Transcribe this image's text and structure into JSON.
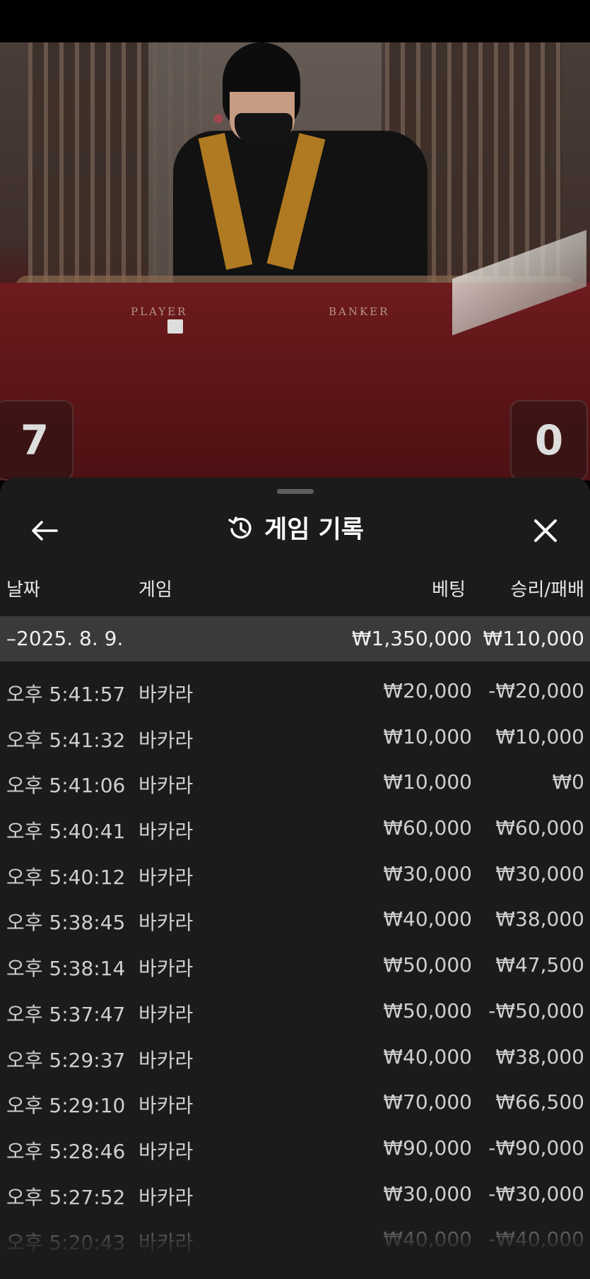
{
  "video": {
    "table_labels": [
      "PLAYER",
      "BANKER"
    ],
    "player_score": "7",
    "banker_score": "0"
  },
  "history": {
    "title": "게임 기록",
    "columns": {
      "date": "날짜",
      "game": "게임",
      "bet": "베팅",
      "result": "승리/패배"
    },
    "group": {
      "date": "–2025. 8. 9.",
      "bet_total": "₩1,350,000",
      "result_total": "₩110,000"
    },
    "rows": [
      {
        "time": "오후 5:41:57",
        "game": "바카라",
        "bet": "₩20,000",
        "result": "-₩20,000"
      },
      {
        "time": "오후 5:41:32",
        "game": "바카라",
        "bet": "₩10,000",
        "result": "₩10,000"
      },
      {
        "time": "오후 5:41:06",
        "game": "바카라",
        "bet": "₩10,000",
        "result": "₩0"
      },
      {
        "time": "오후 5:40:41",
        "game": "바카라",
        "bet": "₩60,000",
        "result": "₩60,000"
      },
      {
        "time": "오후 5:40:12",
        "game": "바카라",
        "bet": "₩30,000",
        "result": "₩30,000"
      },
      {
        "time": "오후 5:38:45",
        "game": "바카라",
        "bet": "₩40,000",
        "result": "₩38,000"
      },
      {
        "time": "오후 5:38:14",
        "game": "바카라",
        "bet": "₩50,000",
        "result": "₩47,500"
      },
      {
        "time": "오후 5:37:47",
        "game": "바카라",
        "bet": "₩50,000",
        "result": "-₩50,000"
      },
      {
        "time": "오후 5:29:37",
        "game": "바카라",
        "bet": "₩40,000",
        "result": "₩38,000"
      },
      {
        "time": "오후 5:29:10",
        "game": "바카라",
        "bet": "₩70,000",
        "result": "₩66,500"
      },
      {
        "time": "오후 5:28:46",
        "game": "바카라",
        "bet": "₩90,000",
        "result": "-₩90,000"
      },
      {
        "time": "오후 5:27:52",
        "game": "바카라",
        "bet": "₩30,000",
        "result": "-₩30,000"
      },
      {
        "time": "오후 5:20:43",
        "game": "바카라",
        "bet": "₩40,000",
        "result": "-₩40,000"
      }
    ]
  },
  "icons": {
    "back": "arrow-left-icon",
    "history": "history-icon",
    "close": "close-icon"
  },
  "colors": {
    "sheet_bg": "#1b1b1b",
    "group_row_bg": "#3a3a3a"
  }
}
